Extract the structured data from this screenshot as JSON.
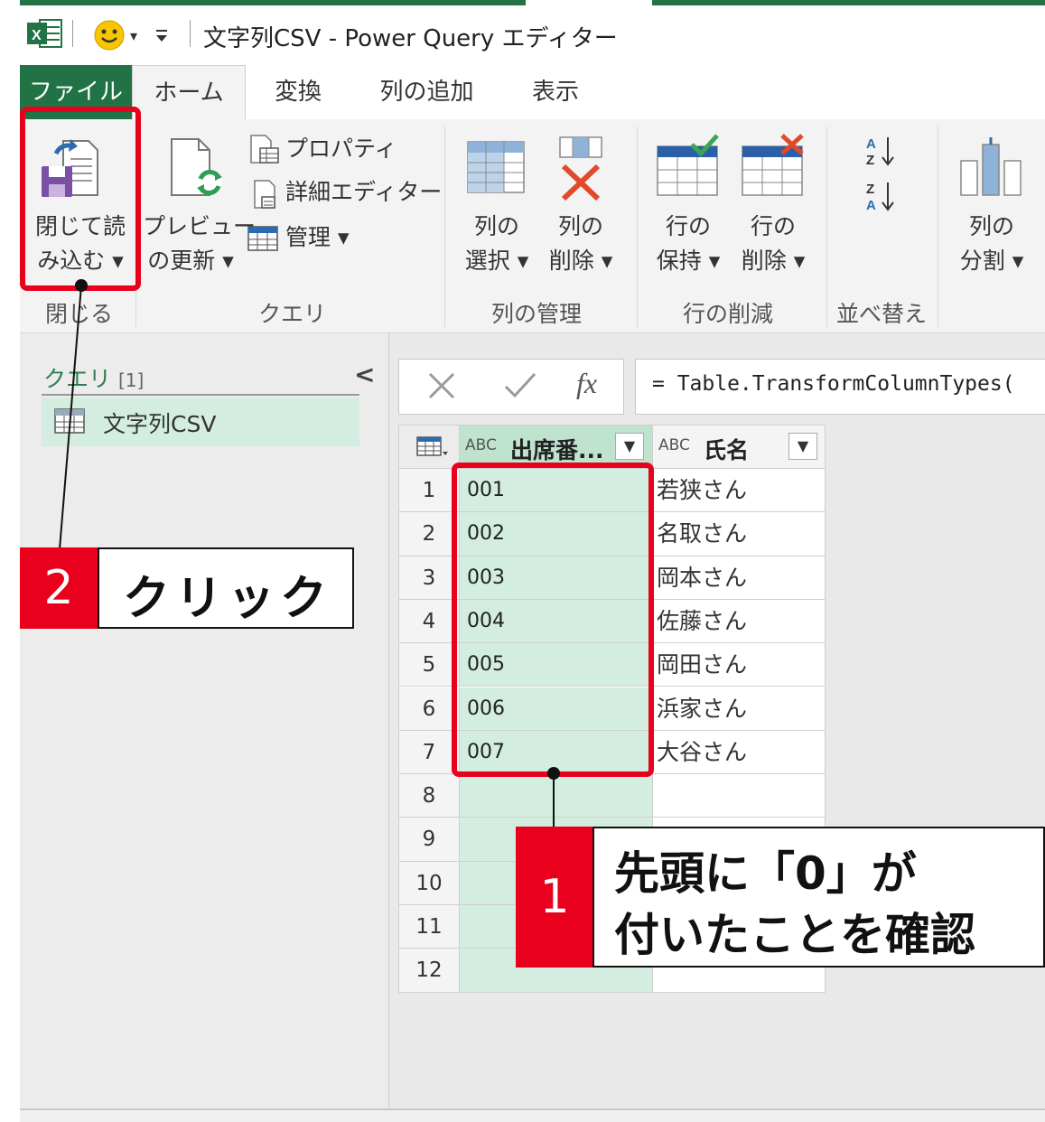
{
  "window": {
    "title": "文字列CSV - Power Query エディター",
    "app_icon": "excel-icon",
    "quick_access": [
      "smiley-icon",
      "dropdown-arrow-icon",
      "customize-arrow-icon"
    ]
  },
  "tabs": [
    {
      "label": "ファイル",
      "active": false,
      "accent": "#217346"
    },
    {
      "label": "ホーム",
      "active": true
    },
    {
      "label": "変換",
      "active": false
    },
    {
      "label": "列の追加",
      "active": false
    },
    {
      "label": "表示",
      "active": false
    }
  ],
  "ribbon": {
    "close_group": {
      "label": "閉じる",
      "close_load": {
        "line1": "閉じて読",
        "line2": "み込む ▾"
      }
    },
    "query_group": {
      "label": "クエリ",
      "refresh_preview": {
        "line1": "プレビュー",
        "line2": "の更新 ▾"
      },
      "properties": "プロパティ",
      "advanced_editor": "詳細エディター",
      "manage": "管理 ▾"
    },
    "columns_group": {
      "label": "列の管理",
      "choose": {
        "line1": "列の",
        "line2": "選択 ▾"
      },
      "remove": {
        "line1": "列の",
        "line2": "削除 ▾"
      }
    },
    "rows_group": {
      "label": "行の削減",
      "keep": {
        "line1": "行の",
        "line2": "保持 ▾"
      },
      "remove": {
        "line1": "行の",
        "line2": "削除 ▾"
      }
    },
    "sort_group": {
      "label": "並べ替え"
    },
    "split": {
      "line1": "列の",
      "line2": "分割 ▾"
    }
  },
  "query_pane": {
    "header": "クエリ",
    "count": "[1]",
    "collapse": "<",
    "items": [
      "文字列CSV"
    ]
  },
  "formula_bar": {
    "formula": "= Table.TransformColumnTypes("
  },
  "table": {
    "columns": [
      {
        "type": "ABC",
        "name": "出席番..."
      },
      {
        "type": "ABC",
        "name": "氏名"
      }
    ],
    "rows": [
      {
        "n": "1",
        "id": "001",
        "name": "若狭さん"
      },
      {
        "n": "2",
        "id": "002",
        "name": "名取さん"
      },
      {
        "n": "3",
        "id": "003",
        "name": "岡本さん"
      },
      {
        "n": "4",
        "id": "004",
        "name": "佐藤さん"
      },
      {
        "n": "5",
        "id": "005",
        "name": "岡田さん"
      },
      {
        "n": "6",
        "id": "006",
        "name": "浜家さん"
      },
      {
        "n": "7",
        "id": "007",
        "name": "大谷さん"
      },
      {
        "n": "8",
        "id": "",
        "name": ""
      },
      {
        "n": "9",
        "id": "",
        "name": ""
      },
      {
        "n": "10",
        "id": "",
        "name": ""
      },
      {
        "n": "11",
        "id": "",
        "name": ""
      },
      {
        "n": "12",
        "id": "",
        "name": ""
      }
    ]
  },
  "annotations": {
    "step1": {
      "number": "1",
      "line1": "先頭に「0」が",
      "line2": "付いたことを確認"
    },
    "step2": {
      "number": "2",
      "text": "クリック"
    },
    "accent": "#e8001c"
  }
}
